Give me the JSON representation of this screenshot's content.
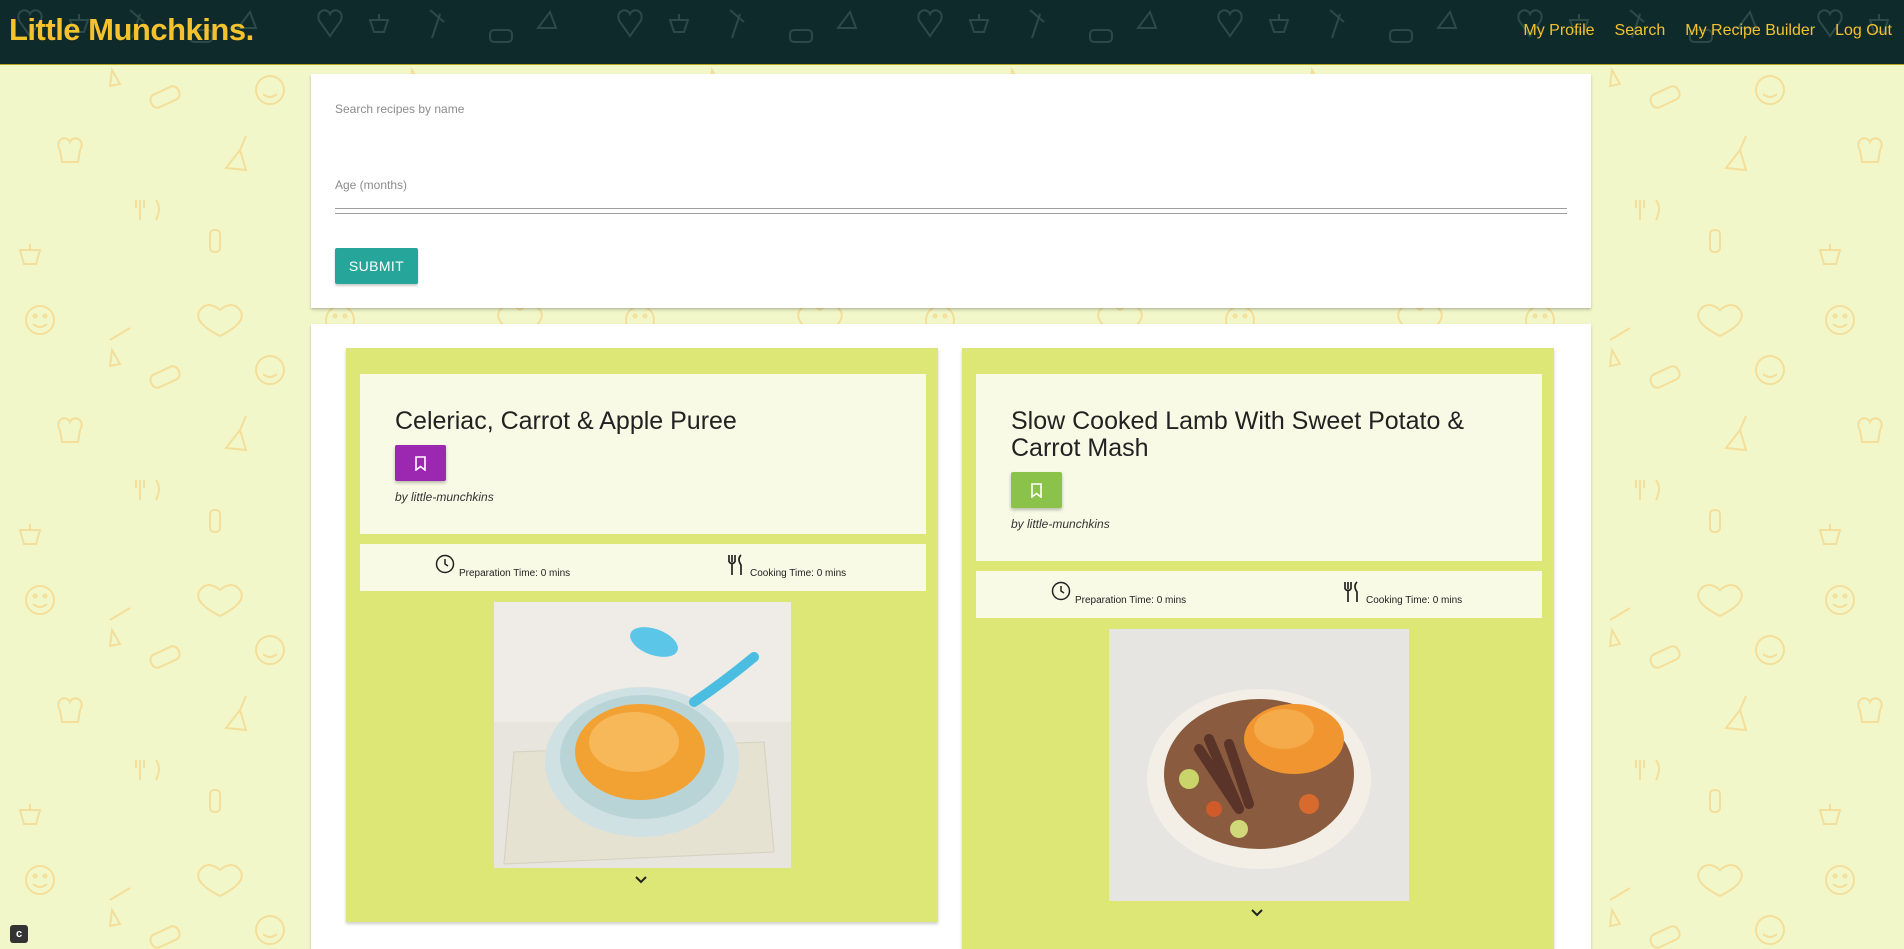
{
  "nav": {
    "brand": "Little Munchkins.",
    "links": [
      "My Profile",
      "Search",
      "My Recipe Builder",
      "Log Out"
    ]
  },
  "search_form": {
    "name_label": "Search recipes by name",
    "name_value": "",
    "age_label": "Age (months)",
    "age_value": "",
    "submit_label": "SUBMIT"
  },
  "recipes": [
    {
      "title": "Celeriac, Carrot & Apple Puree",
      "author": "by little-munchkins",
      "prep_time": "Preparation Time: 0 mins",
      "cook_time": "Cooking Time: 0 mins",
      "save_color": "#9c27b0",
      "image_icon": "bowl-of-orange-puree"
    },
    {
      "title": "Slow Cooked Lamb With Sweet Potato & Carrot Mash",
      "author": "by little-munchkins",
      "prep_time": "Preparation Time: 0 mins",
      "cook_time": "Cooking Time: 0 mins",
      "save_color": "#8bc34a",
      "image_icon": "bowl-of-lamb-stew"
    }
  ],
  "colors": {
    "navbar": "#0f2a2a",
    "brand": "#f5c22e",
    "page_bg": "#f1f7c9",
    "card_bg": "#dce775",
    "submit": "#26a69a"
  }
}
